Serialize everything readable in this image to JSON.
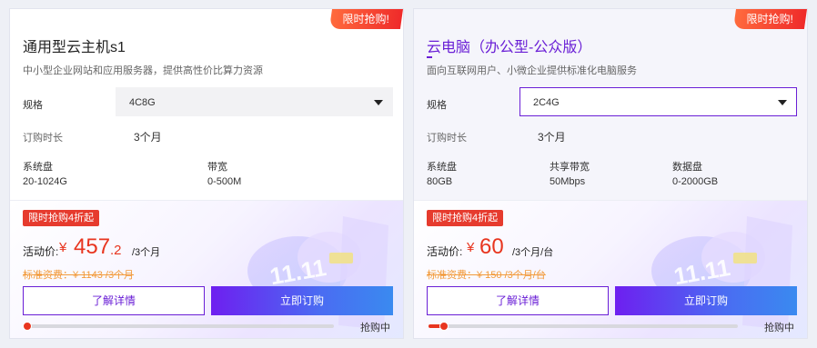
{
  "cards": [
    {
      "ribbon": "限时抢购!",
      "title": "通用型云主机s1",
      "desc": "中小型企业网站和应用服务器，提供高性价比算力资源",
      "spec_label": "规格",
      "spec_value": "4C8G",
      "period_label": "订购时长",
      "period_value": "3个月",
      "specs": [
        {
          "label": "系统盘",
          "value": "20-1024G"
        },
        {
          "label": "带宽",
          "value": "0-500M"
        }
      ],
      "badge": "限时抢购4折起",
      "price_label": "活动价:",
      "currency": "¥",
      "price_int": "457",
      "price_dec": ".2",
      "price_unit": "/3个月",
      "orig_price": "标准资费：¥ 1143 /3个月",
      "detail_btn": "了解详情",
      "buy_btn": "立即订购",
      "progress": 0.0,
      "status": "抢购中"
    },
    {
      "ribbon": "限时抢购!",
      "title": "云电脑（办公型-公众版）",
      "desc": "面向互联网用户、小微企业提供标准化电脑服务",
      "spec_label": "规格",
      "spec_value": "2C4G",
      "period_label": "订购时长",
      "period_value": "3个月",
      "specs": [
        {
          "label": "系统盘",
          "value": "80GB"
        },
        {
          "label": "共享带宽",
          "value": "50Mbps"
        },
        {
          "label": "数据盘",
          "value": "0-2000GB"
        }
      ],
      "badge": "限时抢购4折起",
      "price_label": "活动价:",
      "currency": "¥",
      "price_int": "60",
      "price_dec": "",
      "price_unit": "/3个月/台",
      "orig_price": "标准资费：¥ 150 /3个月/台",
      "detail_btn": "了解详情",
      "buy_btn": "立即订购",
      "progress": 0.06,
      "status": "抢购中"
    }
  ],
  "colors": {
    "accent": "#6a1fd6",
    "price": "#e8351f",
    "orig": "#f29a3a",
    "badge": "#e63b2e"
  }
}
